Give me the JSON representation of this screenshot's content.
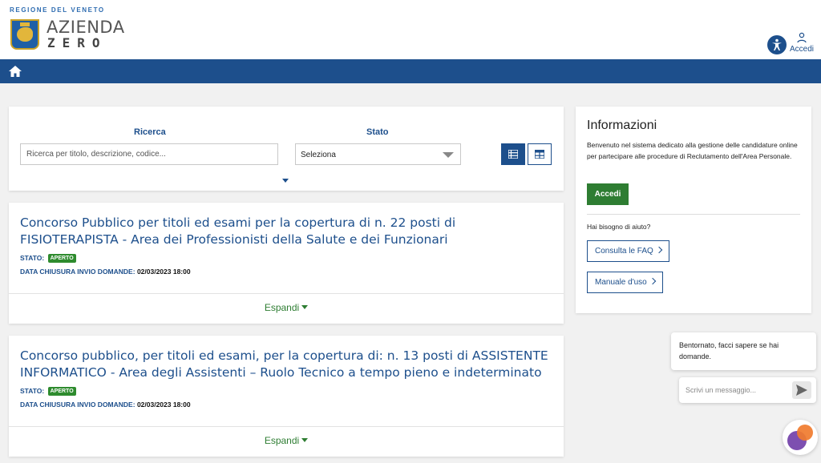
{
  "header": {
    "region": "REGIONE DEL VENETO",
    "brand_line1": "AZIENDA",
    "brand_line2": "ZERO",
    "login_label": "Accedi"
  },
  "search": {
    "search_label": "Ricerca",
    "search_placeholder": "Ricerca per titolo, descrizione, codice...",
    "status_label": "Stato",
    "status_value": "Seleziona"
  },
  "competitions": [
    {
      "title": "Concorso Pubblico per titoli ed esami per la copertura di n. 22 posti di FISIOTERAPISTA - Area dei Professionisti della Salute e dei Funzionari",
      "status_label": "STATO:",
      "status": "APERTO",
      "deadline_label": "DATA CHIUSURA INVIO DOMANDE:",
      "deadline": "02/03/2023 18:00",
      "expand_label": "Espandi"
    },
    {
      "title": "Concorso pubblico, per titoli ed esami, per la copertura di: n. 13 posti di ASSISTENTE INFORMATICO - Area degli Assistenti – Ruolo Tecnico a tempo pieno e indeterminato",
      "status_label": "STATO:",
      "status": "APERTO",
      "deadline_label": "DATA CHIUSURA INVIO DOMANDE:",
      "deadline": "02/03/2023 18:00",
      "expand_label": "Espandi"
    }
  ],
  "info": {
    "title": "Informazioni",
    "text": "Benvenuto nel sistema dedicato alla gestione delle candidature online per partecipare alle procedure di Reclutamento dell'Area Personale.",
    "login_button": "Accedi",
    "help_text": "Hai bisogno di aiuto?",
    "faq_button": "Consulta le FAQ",
    "manual_button": "Manuale d'uso"
  },
  "chat": {
    "message": "Bentornato, facci sapere se hai domande.",
    "input_placeholder": "Scrivi un messaggio..."
  },
  "colors": {
    "primary": "#1d4f8c",
    "success": "#2e7d32",
    "background": "#f1f1f1"
  },
  "icons": [
    "home-icon",
    "accessibility-icon",
    "user-icon",
    "list-view-icon",
    "grid-view-icon",
    "send-icon",
    "chevron-right-icon",
    "caret-down-icon"
  ]
}
